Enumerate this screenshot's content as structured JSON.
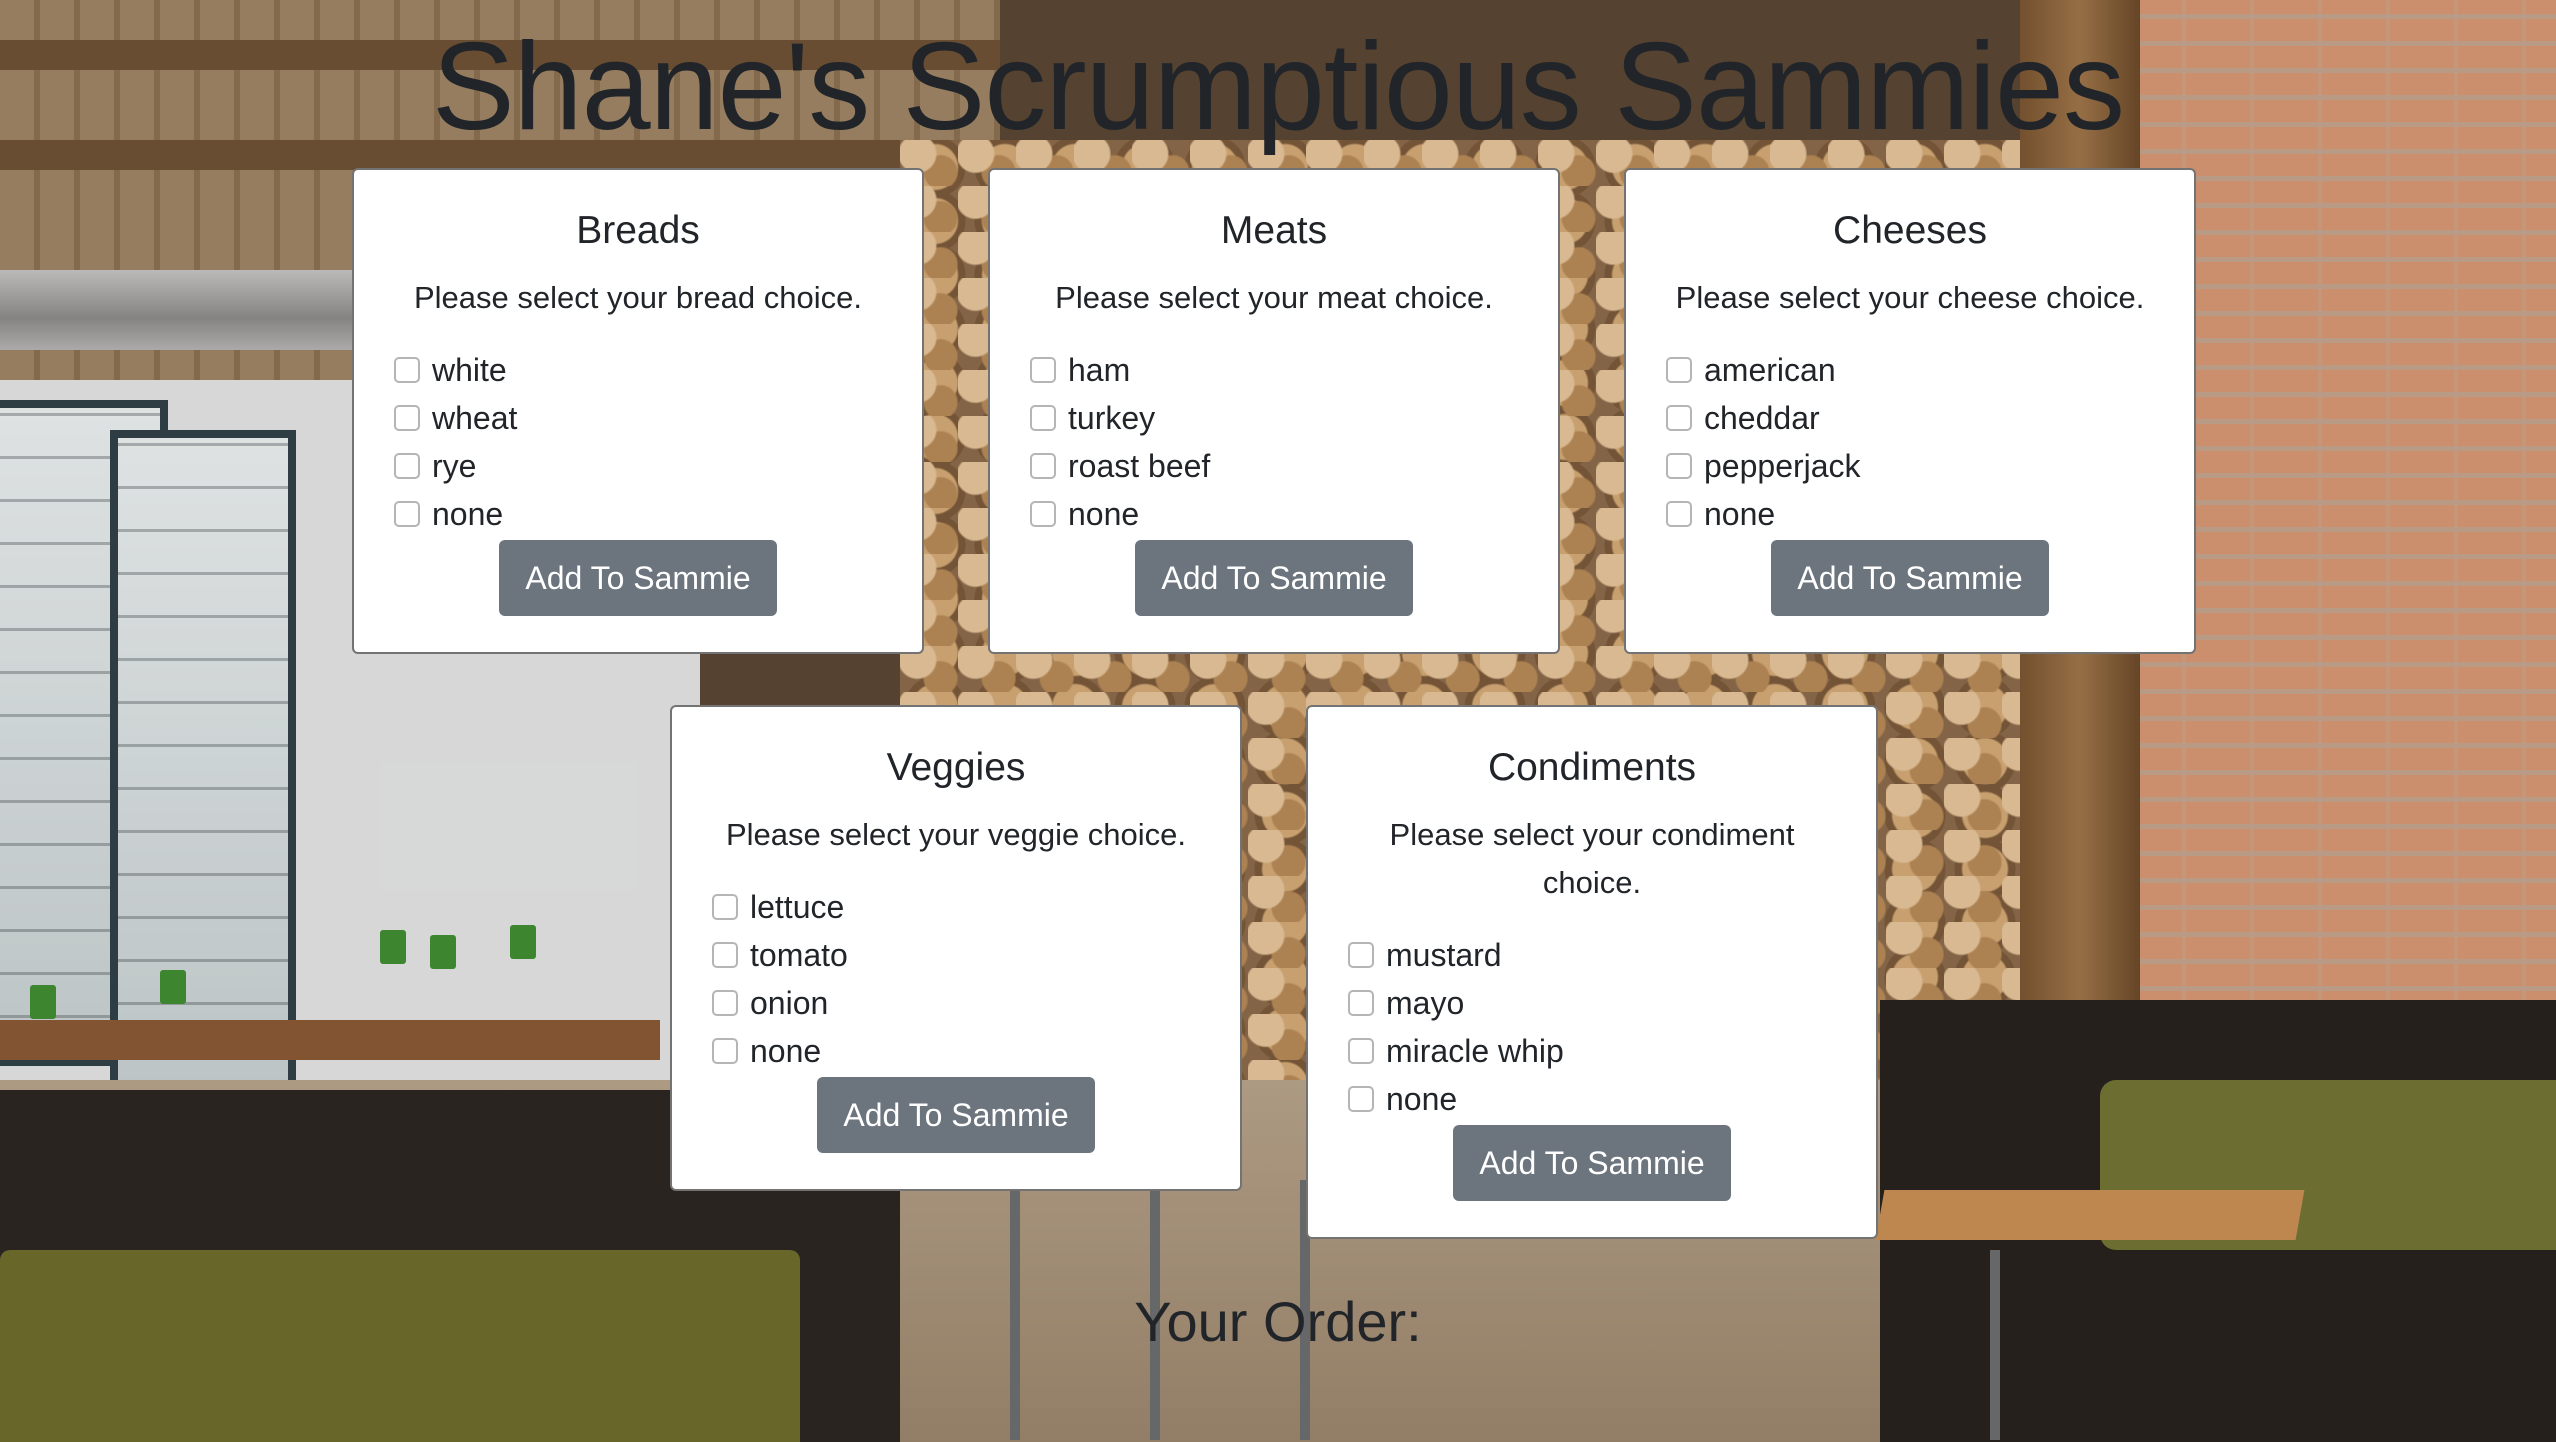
{
  "page": {
    "title": "Shane's Scrumptious Sammies",
    "order_heading": "Your Order:"
  },
  "cards": {
    "breads": {
      "title": "Breads",
      "prompt": "Please select your bread choice.",
      "options": [
        "white",
        "wheat",
        "rye",
        "none"
      ],
      "button": "Add To Sammie"
    },
    "meats": {
      "title": "Meats",
      "prompt": "Please select your meat choice.",
      "options": [
        "ham",
        "turkey",
        "roast beef",
        "none"
      ],
      "button": "Add To Sammie"
    },
    "cheeses": {
      "title": "Cheeses",
      "prompt": "Please select your cheese choice.",
      "options": [
        "american",
        "cheddar",
        "pepperjack",
        "none"
      ],
      "button": "Add To Sammie"
    },
    "veggies": {
      "title": "Veggies",
      "prompt": "Please select your veggie choice.",
      "options": [
        "lettuce",
        "tomato",
        "onion",
        "none"
      ],
      "button": "Add To Sammie"
    },
    "condiments": {
      "title": "Condiments",
      "prompt": "Please select your condiment choice.",
      "options": [
        "mustard",
        "mayo",
        "miracle whip",
        "none"
      ],
      "button": "Add To Sammie"
    }
  },
  "colors": {
    "button_bg": "#6c757d",
    "button_text": "#ffffff",
    "card_bg": "#ffffff",
    "text": "#212529"
  }
}
